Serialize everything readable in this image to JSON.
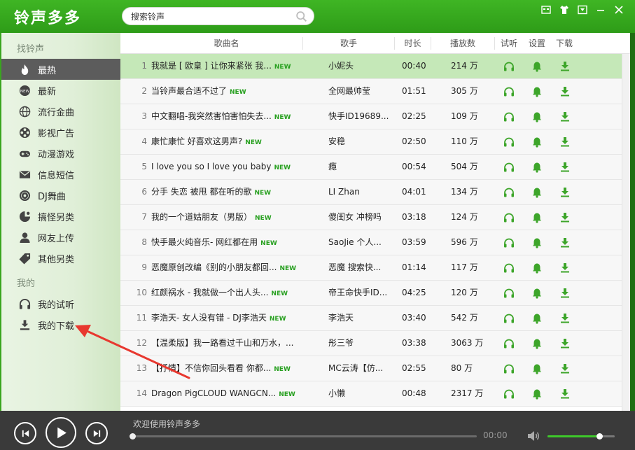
{
  "app": {
    "title": "铃声多多"
  },
  "search": {
    "placeholder": "搜索铃声"
  },
  "window_buttons": [
    {
      "icon": "skin-icon"
    },
    {
      "icon": "shirt-icon"
    },
    {
      "icon": "menu-icon"
    },
    {
      "icon": "minimize-icon"
    },
    {
      "icon": "close-icon"
    }
  ],
  "sidebar": {
    "section_find": "找铃声",
    "section_mine": "我的",
    "items": [
      {
        "label": "最热",
        "icon": "fire-icon",
        "active": true
      },
      {
        "label": "最新",
        "icon": "new-badge-icon"
      },
      {
        "label": "流行金曲",
        "icon": "globe-icon"
      },
      {
        "label": "影视广告",
        "icon": "film-reel-icon"
      },
      {
        "label": "动漫游戏",
        "icon": "gamepad-icon"
      },
      {
        "label": "信息短信",
        "icon": "envelope-icon"
      },
      {
        "label": "DJ舞曲",
        "icon": "dj-disc-icon"
      },
      {
        "label": "搞怪另类",
        "icon": "funny-icon"
      },
      {
        "label": "网友上传",
        "icon": "user-icon"
      },
      {
        "label": "其他另类",
        "icon": "tag-icon"
      }
    ],
    "mine_items": [
      {
        "label": "我的试听",
        "icon": "headphones-icon"
      },
      {
        "label": "我的下载",
        "icon": "download-icon"
      }
    ]
  },
  "table": {
    "headers": {
      "name": "歌曲名",
      "artist": "歌手",
      "duration": "时长",
      "plays": "播放数",
      "listen": "试听",
      "set": "设置",
      "download": "下载"
    },
    "new_label": "NEW",
    "rows": [
      {
        "num": "1",
        "name": "我就是 [ 欧皇 ] 让你来紧张  我...",
        "artist": "小妮头",
        "duration": "00:40",
        "plays": "214 万",
        "selected": true
      },
      {
        "num": "2",
        "name": "当铃声最合适不过了",
        "artist": "全网最帅莹",
        "duration": "01:51",
        "plays": "305 万"
      },
      {
        "num": "3",
        "name": "中文翻唱-我突然害怕害怕失去...",
        "artist": "快手ID19689...",
        "duration": "02:25",
        "plays": "109 万"
      },
      {
        "num": "4",
        "name": "康忙康忙  好喜欢这男声?",
        "artist": "安稳",
        "duration": "02:50",
        "plays": "110 万"
      },
      {
        "num": "5",
        "name": "I love you so I love you baby",
        "artist": "瘾",
        "duration": "00:54",
        "plays": "504 万"
      },
      {
        "num": "6",
        "name": "分手    失恋   被甩   都在听的歌",
        "artist": "LI  Zhan",
        "duration": "04:01",
        "plays": "134 万"
      },
      {
        "num": "7",
        "name": "我的一个道姑朋友（男版）",
        "artist": "傻闺女   冲榜吗",
        "duration": "03:18",
        "plays": "124 万"
      },
      {
        "num": "8",
        "name": "快手最火纯音乐- 网红都在用",
        "artist": "SaoJie  个人...",
        "duration": "03:59",
        "plays": "596 万"
      },
      {
        "num": "9",
        "name": "恶魔原创改编《别的小朋友都回...",
        "artist": "恶魔    搜索快...",
        "duration": "01:14",
        "plays": "117 万"
      },
      {
        "num": "10",
        "name": "红颜祸水   -   我就做一个出人头...",
        "artist": "帝王命快手ID...",
        "duration": "04:25",
        "plays": "120 万"
      },
      {
        "num": "11",
        "name": "李浩天- 女人没有错  - DJ李浩天",
        "artist": "李浩天",
        "duration": "03:40",
        "plays": "542 万"
      },
      {
        "num": "12",
        "name": "【温柔版】我一路看过千山和万水，...",
        "artist": "彤三爷",
        "duration": "03:38",
        "plays": "3063 万",
        "no_new": true
      },
      {
        "num": "13",
        "name": "【抒情】不信你回头看看  你都...",
        "artist": "MC云涛【仿...",
        "duration": "02:55",
        "plays": "80 万"
      },
      {
        "num": "14",
        "name": "Dragon  PigCLOUD  WANGCN...",
        "artist": "小懒",
        "duration": "00:48",
        "plays": "2317 万"
      }
    ]
  },
  "player": {
    "now_playing": "欢迎使用铃声多多",
    "time": "00:00",
    "progress": 0,
    "volume": 0.77
  },
  "colors": {
    "accent": "#3aa51f",
    "action_green": "#3da52a",
    "selected_row": "#c5e8b8",
    "annotation": "#e8382f"
  }
}
